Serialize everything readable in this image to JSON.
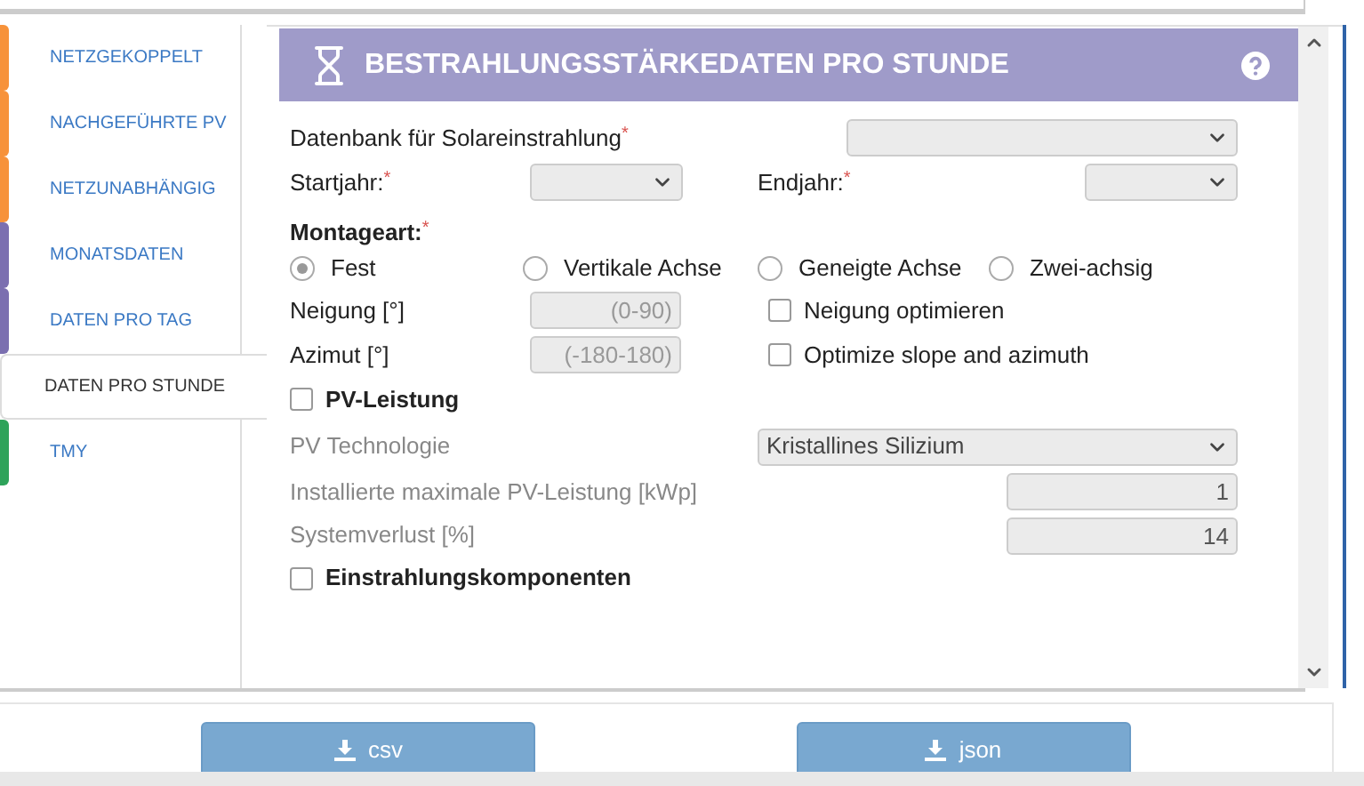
{
  "sidebar": {
    "tabs": [
      {
        "label": "NETZGEKOPPELT",
        "color": "#f7923a",
        "selected": false
      },
      {
        "label": "NACHGEFÜHRTE PV",
        "color": "#f7923a",
        "selected": false
      },
      {
        "label": "NETZUNABHÄNGIG",
        "color": "#f7923a",
        "selected": false
      },
      {
        "label": "MONATSDATEN",
        "color": "#7b6fb0",
        "selected": false
      },
      {
        "label": "DATEN PRO TAG",
        "color": "#7b6fb0",
        "selected": false
      },
      {
        "label": "DATEN PRO STUNDE",
        "selected": true
      },
      {
        "label": "TMY",
        "color": "#2ea35a",
        "selected": false
      }
    ]
  },
  "panel": {
    "title": "BESTRAHLUNGSSTÄRKEDATEN PRO STUNDE",
    "database": {
      "label": "Datenbank für Solareinstrahlung",
      "mark": "*"
    },
    "start_year": {
      "label": "Startjahr:",
      "mark": "*"
    },
    "end_year": {
      "label": "Endjahr:",
      "mark": "*"
    },
    "mounting": {
      "label": "Montageart:",
      "mark": "*",
      "options": [
        {
          "label": "Fest",
          "selected": true
        },
        {
          "label": "Vertikale Achse",
          "selected": false
        },
        {
          "label": "Geneigte Achse",
          "selected": false
        },
        {
          "label": "Zwei-achsig",
          "selected": false
        }
      ]
    },
    "slope": {
      "label": "Neigung [°]",
      "placeholder": "(0-90)"
    },
    "azimuth": {
      "label": "Azimut [°]",
      "placeholder": "(-180-180)"
    },
    "optimize": [
      {
        "label": "Neigung optimieren",
        "checked": false
      },
      {
        "label": "Optimize slope and azimuth",
        "checked": false
      }
    ],
    "pv_output": {
      "label": "PV-Leistung",
      "checked": false
    },
    "pv_technology": {
      "label": "PV Technologie",
      "value": "Kristallines Silizium",
      "disabled": true
    },
    "peak_power": {
      "label": "Installierte maximale PV-Leistung [kWp]",
      "value": "1",
      "disabled": true
    },
    "system_loss": {
      "label": "Systemverlust [%]",
      "value": "14",
      "disabled": true
    },
    "components": {
      "label": "Einstrahlungskomponenten",
      "checked": false
    }
  },
  "buttons": [
    {
      "label": "csv"
    },
    {
      "label": "json"
    }
  ]
}
